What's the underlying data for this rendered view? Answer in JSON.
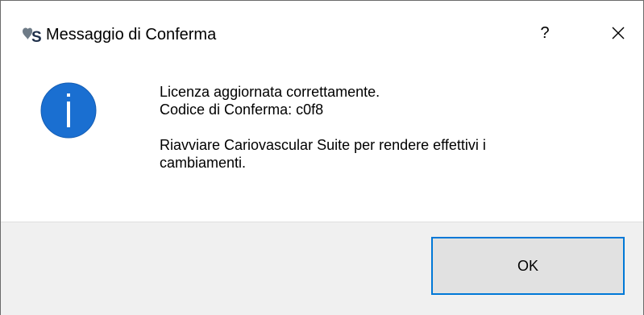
{
  "window": {
    "title": "Messaggio di Conferma",
    "logo_icon": "cardiovascular-suite-logo-icon",
    "help_label": "?",
    "close_label": "✕"
  },
  "message": {
    "icon": "info-icon",
    "line1": "Licenza aggiornata correttamente.",
    "line2": "Codice di Conferma: c0f8",
    "line3": "Riavviare Cariovascular Suite per rendere effettivi i",
    "line4": "cambiamenti."
  },
  "buttons": {
    "ok_label": "OK"
  },
  "colors": {
    "info_icon_blue": "#1a6fd1",
    "button_focus_border": "#0078d7",
    "footer_bg": "#f0f0f0",
    "button_bg": "#e1e1e1"
  }
}
